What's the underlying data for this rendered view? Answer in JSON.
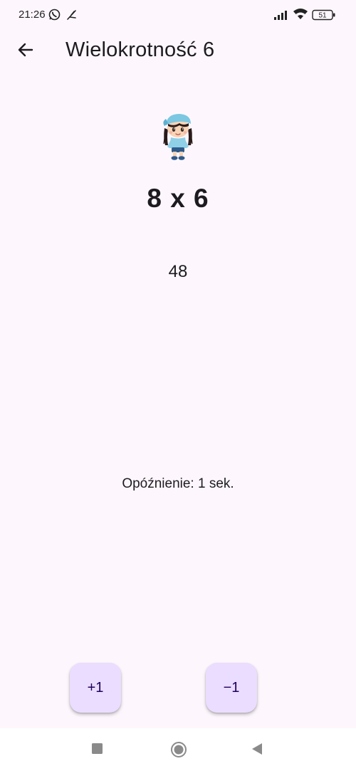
{
  "status_bar": {
    "time": "21:26",
    "battery": "51",
    "icons": [
      "whatsapp-icon",
      "feather-icon",
      "signal-icon",
      "wifi-icon",
      "battery-icon"
    ]
  },
  "app_bar": {
    "back_icon": "arrow-left-icon",
    "title": "Wielokrotność 6"
  },
  "main": {
    "avatar": "girl-character-image",
    "question": "8 x 6",
    "answer": "48",
    "delay_text": "Opóźnienie: 1 sek."
  },
  "buttons": {
    "plus_label": "+1",
    "minus_label": "−1"
  },
  "nav_bar": {
    "icons": [
      "recents-square-icon",
      "home-circle-icon",
      "back-triangle-icon"
    ]
  },
  "colors": {
    "background": "#fdf7fd",
    "button_bg": "#eaddff",
    "button_text": "#21005d",
    "text": "#1d1b20"
  }
}
